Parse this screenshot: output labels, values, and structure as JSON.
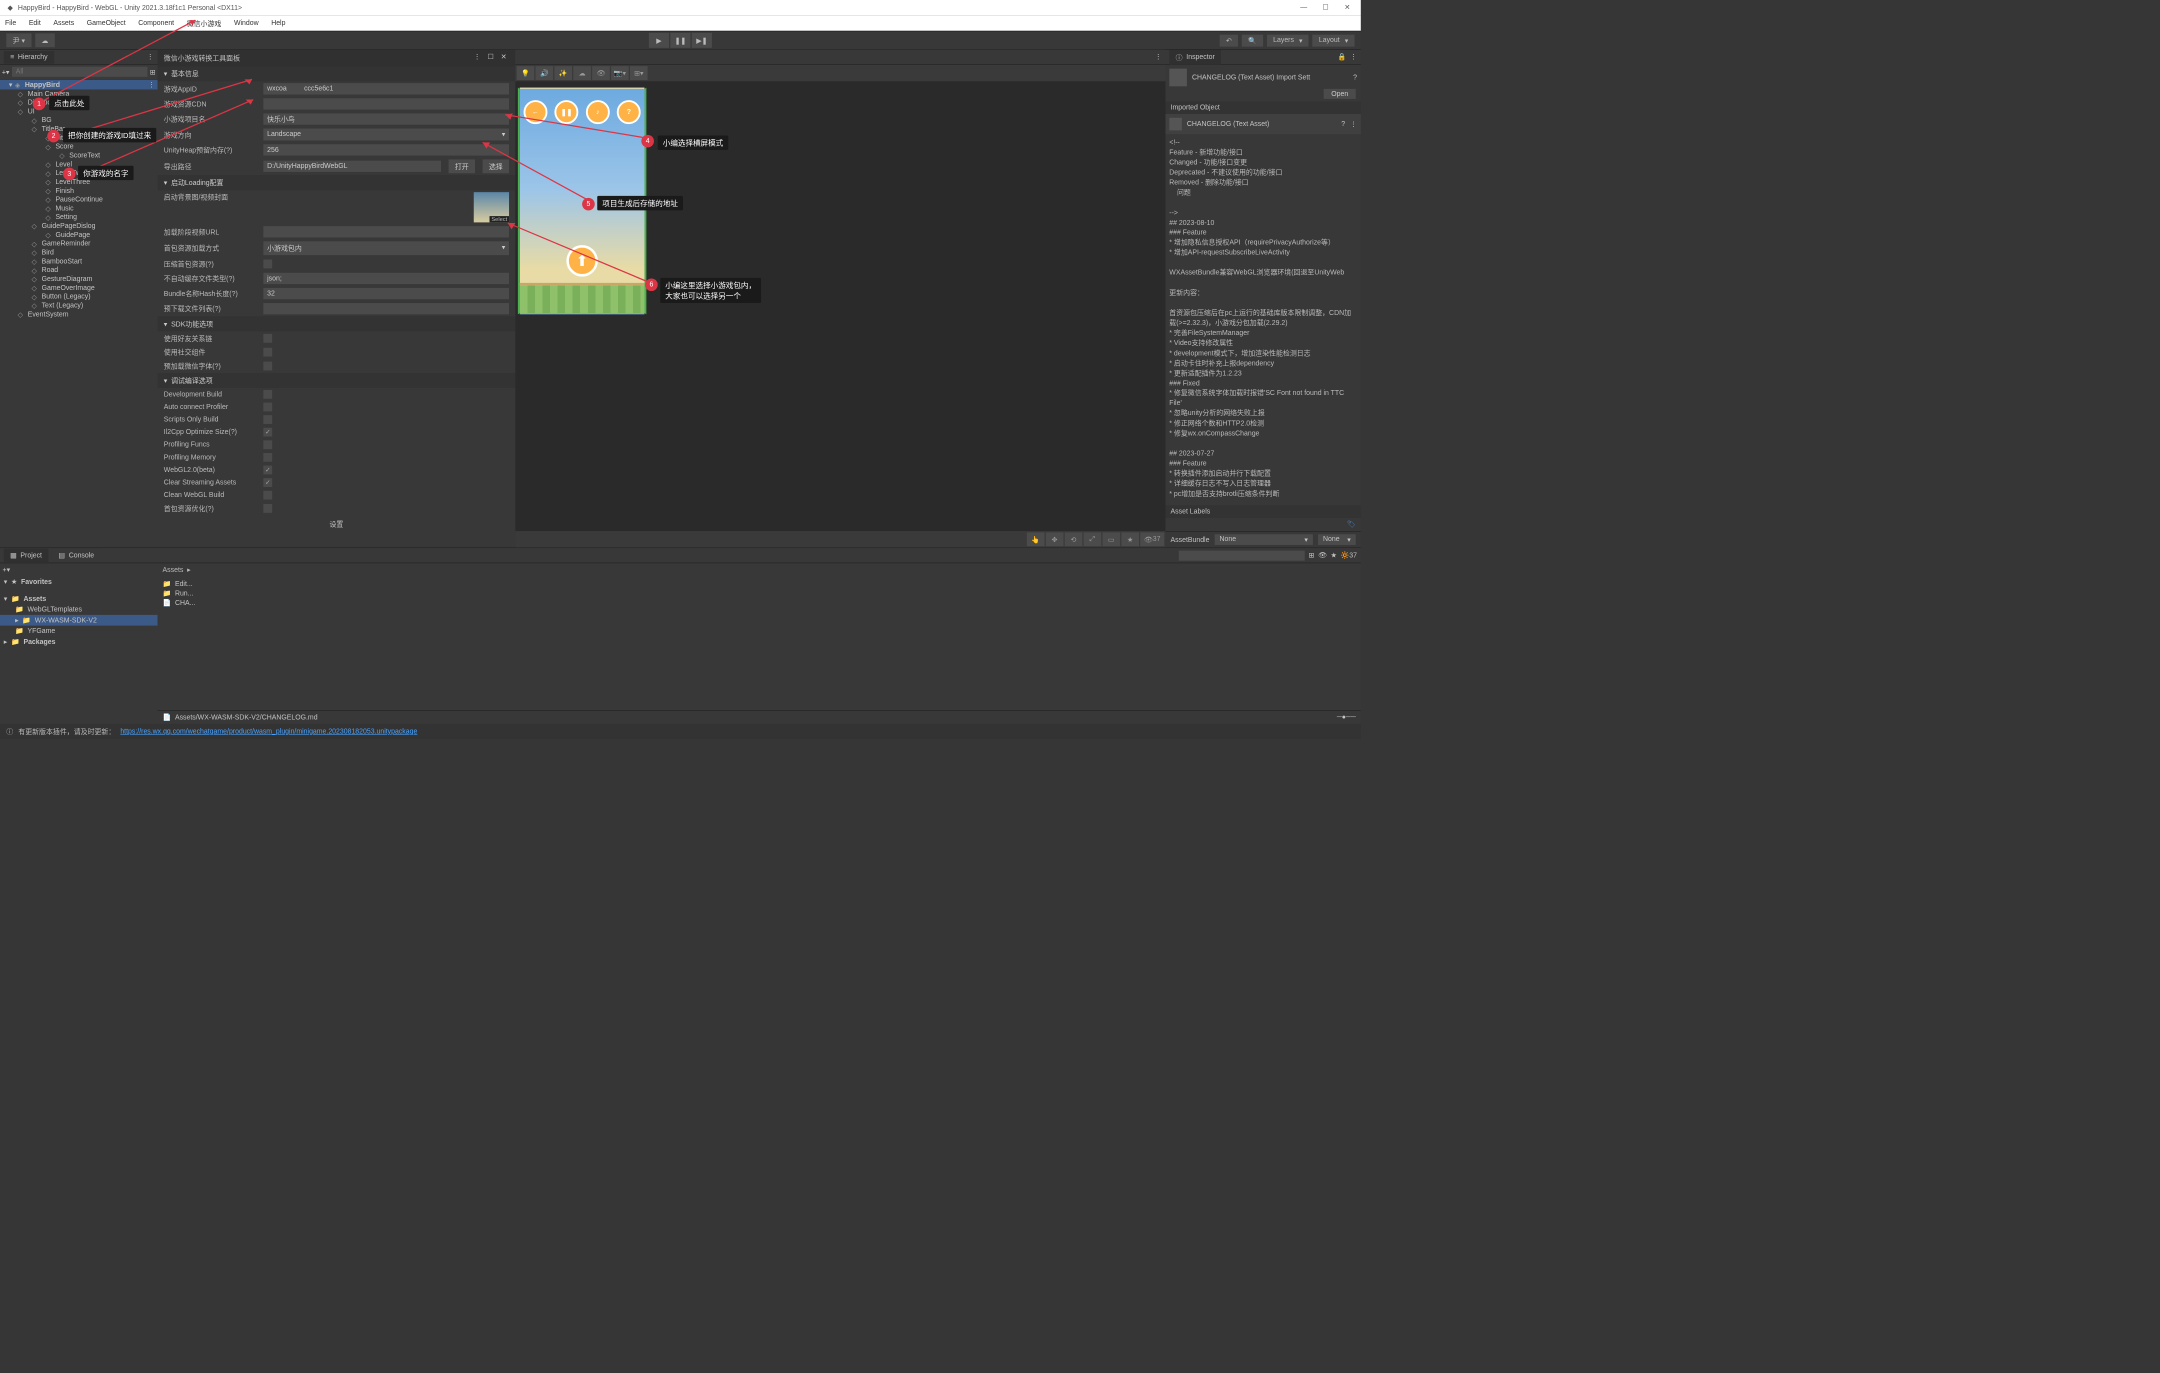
{
  "window": {
    "title": "HappyBird - HappyBird - WebGL - Unity 2021.3.18f1c1 Personal <DX11>"
  },
  "menus": [
    "File",
    "Edit",
    "Assets",
    "GameObject",
    "Component",
    "微信小游戏",
    "Window",
    "Help"
  ],
  "toolbar": {
    "layers": "Layers",
    "layout": "Layout"
  },
  "hierarchy": {
    "title": "Hierarchy",
    "search_ph": "All",
    "scene": "HappyBird",
    "items": [
      {
        "l": "Main Camera",
        "i": 1
      },
      {
        "l": "Directional Light",
        "i": 1
      },
      {
        "l": "UI",
        "i": 1
      },
      {
        "l": "BG",
        "i": 2
      },
      {
        "l": "TitleBar",
        "i": 2
      },
      {
        "l": "TitleBarBG",
        "i": 3
      },
      {
        "l": "Score",
        "i": 3
      },
      {
        "l": "ScoreText",
        "i": 4
      },
      {
        "l": "Level",
        "i": 3
      },
      {
        "l": "LevelTwo",
        "i": 3
      },
      {
        "l": "LevelThree",
        "i": 3
      },
      {
        "l": "Finish",
        "i": 3
      },
      {
        "l": "PauseContinue",
        "i": 3
      },
      {
        "l": "Music",
        "i": 3
      },
      {
        "l": "Setting",
        "i": 3
      },
      {
        "l": "GuidePageDislog",
        "i": 2
      },
      {
        "l": "GuidePage",
        "i": 3
      },
      {
        "l": "GameReminder",
        "i": 2
      },
      {
        "l": "Bird",
        "i": 2
      },
      {
        "l": "BambooStart",
        "i": 2
      },
      {
        "l": "Road",
        "i": 2
      },
      {
        "l": "GestureDiagram",
        "i": 2
      },
      {
        "l": "GameOverImage",
        "i": 2
      },
      {
        "l": "Button (Legacy)",
        "i": 2
      },
      {
        "l": "Text (Legacy)",
        "i": 2
      },
      {
        "l": "EventSystem",
        "i": 1
      }
    ]
  },
  "wechat_panel": {
    "title": "微信小游戏转换工具面板",
    "s_basic": "基本信息",
    "appid_lbl": "游戏AppID",
    "appid_val": "wxcoa         ccc5e6c1",
    "cdn_lbl": "游戏资源CDN",
    "cdn_val": "",
    "name_lbl": "小游戏项目名",
    "name_val": "快乐小鸟",
    "dir_lbl": "游戏方向",
    "dir_val": "Landscape",
    "heap_lbl": "UnityHeap预留内存(?)",
    "heap_val": "256",
    "out_lbl": "导出路径",
    "out_val": "D:/UnityHappyBirdWebGL",
    "open": "打开",
    "choose": "选择",
    "s_loading": "启动Loading配置",
    "cover_lbl": "启动背景图/视频封面",
    "cover_sel": "Select",
    "video_lbl": "加载阶段视频URL",
    "first_lbl": "首包资源加载方式",
    "first_val": "小游戏包内",
    "comp_lbl": "压缩首包资源(?)",
    "nocache_lbl": "不自动缓存文件类型(?)",
    "nocache_val": "json;",
    "hash_lbl": "Bundle名称Hash长度(?)",
    "hash_val": "32",
    "predl_lbl": "预下载文件列表(?)",
    "s_sdk": "SDK功能选项",
    "sdk1": "使用好友关系链",
    "sdk2": "使用社交组件",
    "sdk3": "预加载微信字体(?)",
    "s_debug": "调试编译选项",
    "d1": "Development Build",
    "d2": "Auto connect Profiler",
    "d3": "Scripts Only Build",
    "d4": "Il2Cpp Optimize Size(?)",
    "d5": "Profiling Funcs",
    "d6": "Profiling Memory",
    "d7": "WebGL2.0(beta)",
    "d8": "Clear Streaming Assets",
    "d9": "Clean WebGL Build",
    "d10": "首包资源优化(?)",
    "setting": "设置"
  },
  "inspector": {
    "title": "Inspector",
    "asset": "CHANGELOG (Text Asset) Import Sett",
    "open": "Open",
    "imported": "Imported Object",
    "asset2": "CHANGELOG (Text Asset)",
    "text": "<!--\nFeature - 新增功能/接口\nChanged - 功能/接口变更\nDeprecated - 不建议使用的功能/接口\nRemoved - 删除功能/接口\n    问题\n\n-->\n## 2023-08-10\n### Feature\n* 增加隐私信息授权API（requirePrivacyAuthorize等）\n* 增加API-requestSubscribeLiveActivity\n\nWXAssetBundle兼容WebGL浏览器环境(回退至UnityWeb\n\n更新内容：\n\n首资源包压缩后在pc上运行的基础库版本限制调整，CDN加载(>=2.32.3)，小游戏分包加载(2.29.2)\n* 完善FileSystemManager\n* Video支持修改属性\n* development模式下，增加渲染性能检测日志\n* 启动卡住时补充上报dependency\n* 更新适配插件为1.2.23\n### Fixed\n* 修复微信系统字体加载时报错'SC Font not found in TTC File'\n* 忽略unity分析的网络失败上报\n* 修正网络个数和HTTP2.0检测\n* 修复wx.onCompassChange\n\n## 2023-07-27\n### Feature\n* 转换插件添加启动并行下载配置\n* 详细缓存日志不写入日志管理器\n* pc增加是否支持brotli压缩条件判断",
    "labels": "Asset Labels",
    "ab": "AssetBundle",
    "none": "None",
    "none2": "None"
  },
  "project": {
    "tab1": "Project",
    "tab2": "Console",
    "fav": "Favorites",
    "tree": [
      "Assets",
      "WebGLTemplates",
      "WX-WASM-SDK-V2",
      "YFGame",
      "Packages"
    ],
    "breadcrumb": "Assets",
    "list": [
      "Edit...",
      "Run...",
      "CHA..."
    ],
    "path": "Assets/WX-WASM-SDK-V2/CHANGELOG.md",
    "count": "37"
  },
  "callouts": {
    "c1": "点击此处",
    "c2": "把你创建的游戏ID填过来",
    "c3": "你游戏的名字",
    "c4": "小编选择横屏模式",
    "c5": "项目生成后存储的地址",
    "c6": "小编这里选择小游戏包内，\n大家也可以选择另一个"
  },
  "footer": {
    "msg": "有更新版本插件，请及时更新：",
    "url": "https://res.wx.qq.com/wechatgame/product/wasm_plugin/minigame.202308182053.unitypackage"
  }
}
